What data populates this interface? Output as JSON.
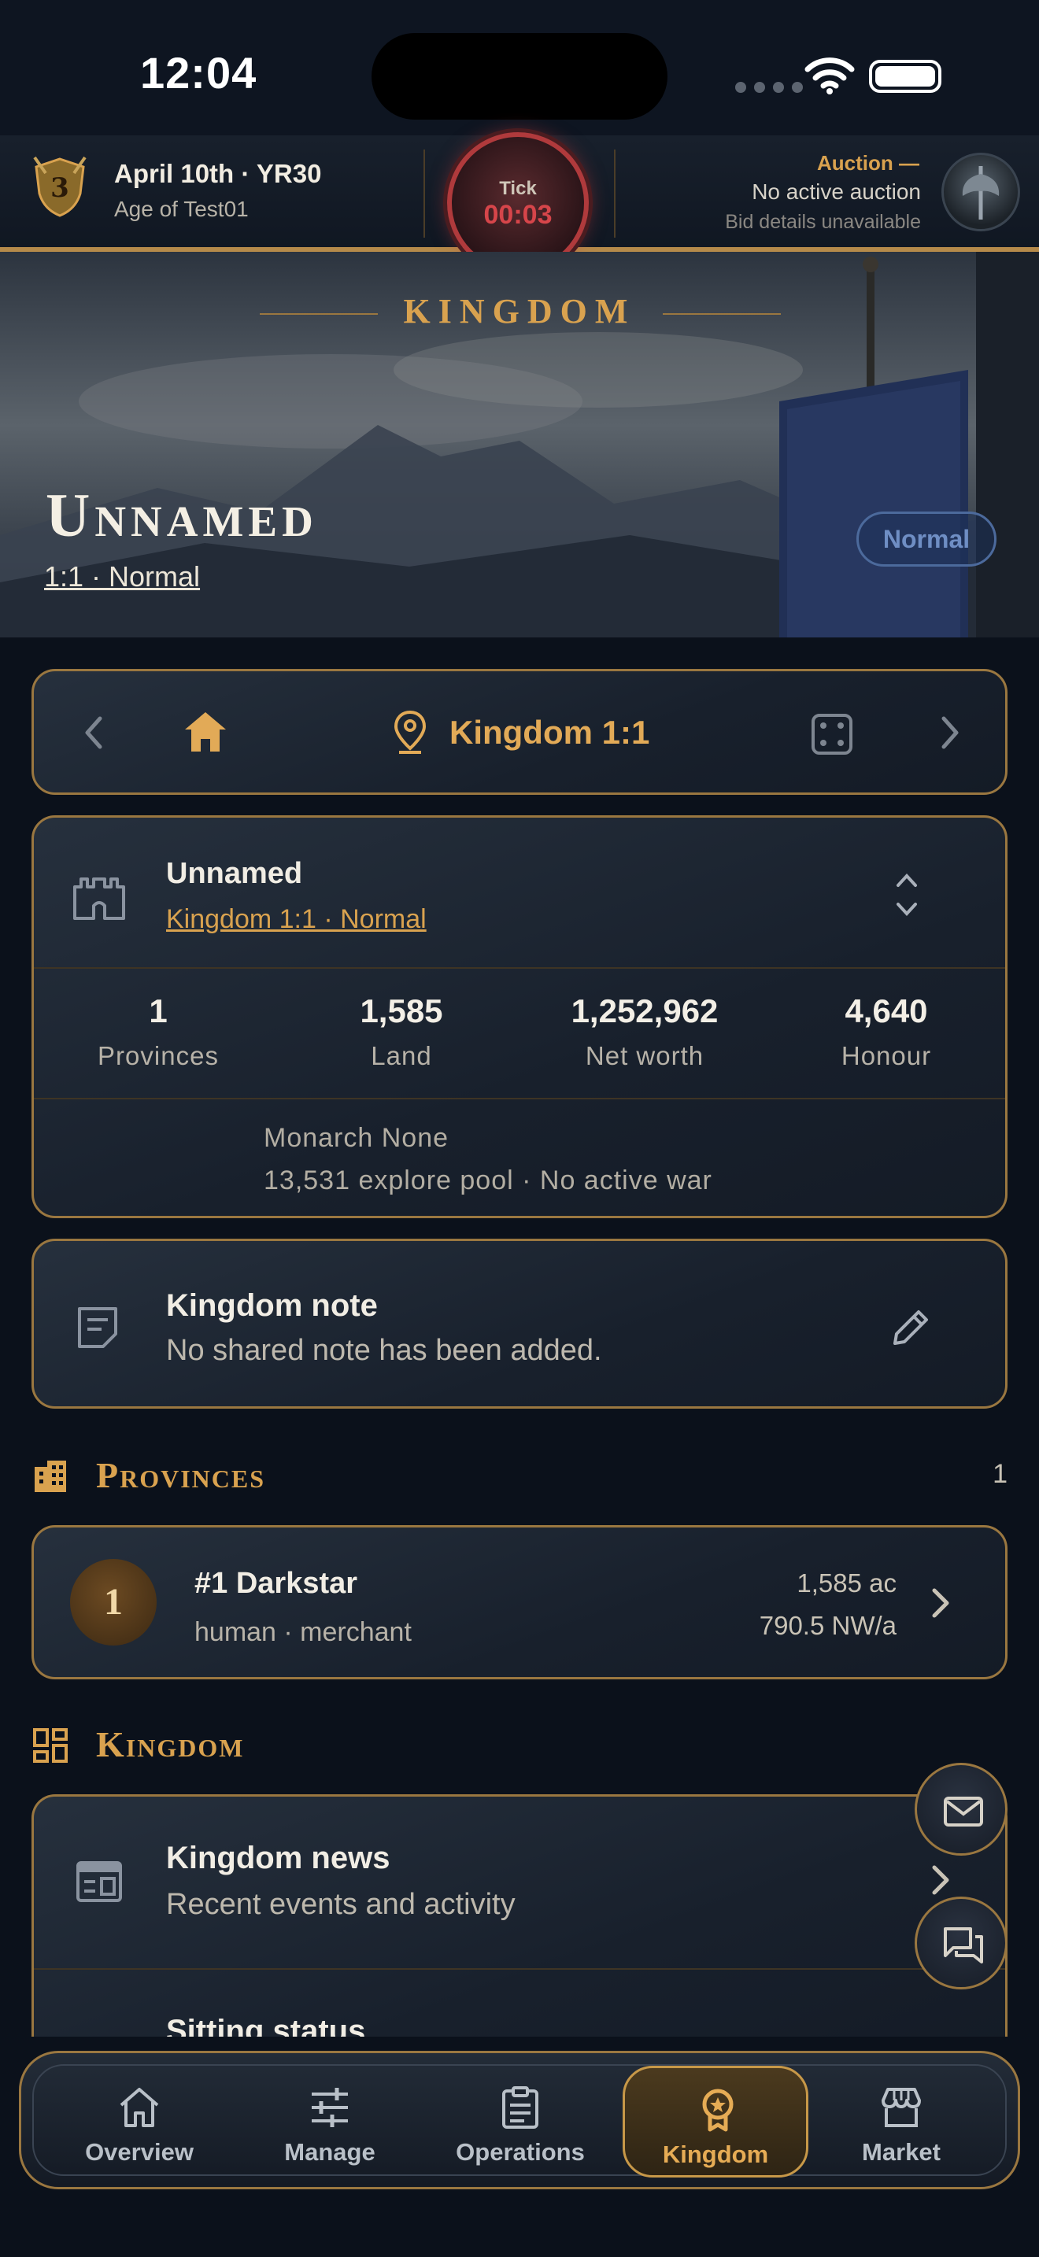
{
  "status_bar": {
    "time": "12:04"
  },
  "topbar": {
    "date": "April 10th · YR30",
    "age": "Age of Test01",
    "tick_label": "Tick",
    "tick_time": "00:03",
    "auction_title": "Auction —",
    "auction_status": "No active auction",
    "auction_detail": "Bid details unavailable"
  },
  "hero": {
    "heading": "KINGDOM",
    "title": "Unnamed",
    "subtitle": "1:1 · Normal",
    "badge": "Normal"
  },
  "nav": {
    "title": "Kingdom 1:1"
  },
  "kingdom_card": {
    "name": "Unnamed",
    "link": "Kingdom 1:1 · Normal",
    "stats": [
      {
        "value": "1",
        "label": "Provinces"
      },
      {
        "value": "1,585",
        "label": "Land"
      },
      {
        "value": "1,252,962",
        "label": "Net worth"
      },
      {
        "value": "4,640",
        "label": "Honour"
      }
    ],
    "monarch": "Monarch None",
    "pool": "13,531 explore pool · No active war"
  },
  "note": {
    "title": "Kingdom note",
    "text": "No shared note has been added."
  },
  "provinces_section": {
    "title": "Provinces",
    "count": "1"
  },
  "provinces": [
    {
      "rank": "1",
      "name": "#1 Darkstar",
      "race": "human · merchant",
      "land": "1,585 ac",
      "nw": "790.5 NW/a"
    }
  ],
  "kingdom_section": {
    "title": "Kingdom"
  },
  "kingdom_links": [
    {
      "title": "Kingdom news",
      "subtitle": "Recent events and activity"
    },
    {
      "title": "Sitting status"
    }
  ],
  "tabs": [
    {
      "label": "Overview",
      "icon": "home-icon"
    },
    {
      "label": "Manage",
      "icon": "sliders-icon"
    },
    {
      "label": "Operations",
      "icon": "clipboard-icon"
    },
    {
      "label": "Kingdom",
      "icon": "medal-icon"
    },
    {
      "label": "Market",
      "icon": "store-icon"
    }
  ],
  "colors": {
    "accent": "#d9a24f",
    "border": "#9a7740",
    "tick": "#d6454a",
    "badge": "#4c6a9c"
  }
}
